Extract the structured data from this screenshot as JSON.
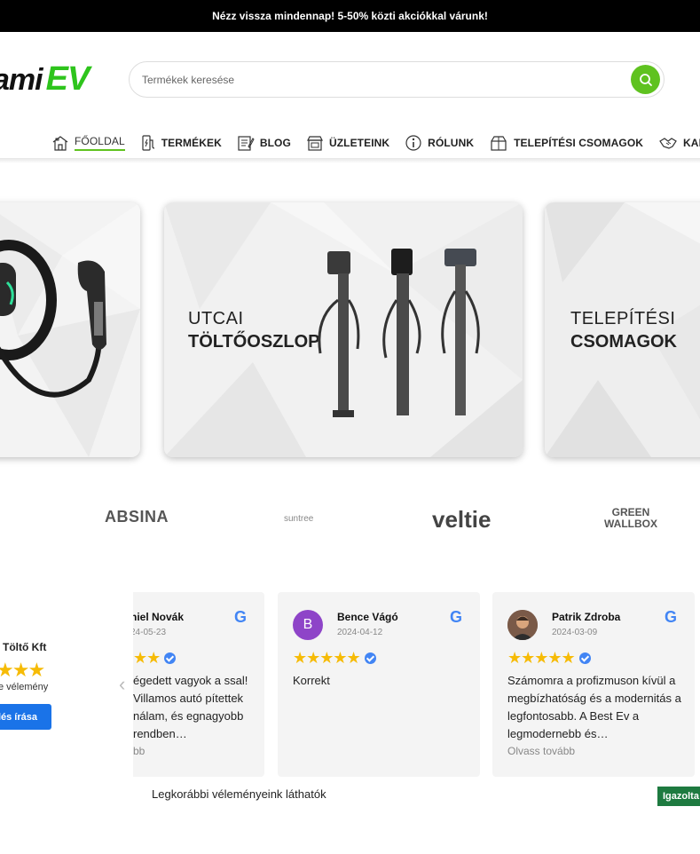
{
  "topbar": {
    "text": "Nézz vissza mindennap! 5-50% közti akciókkal várunk!"
  },
  "logo": {
    "word": "ami",
    "ev": "EV"
  },
  "search": {
    "placeholder": "Termékek keresése"
  },
  "nav": {
    "items": [
      {
        "label": "FŐOLDAL",
        "icon": "home-icon"
      },
      {
        "label": "TERMÉKEK",
        "icon": "charger-icon"
      },
      {
        "label": "BLOG",
        "icon": "blog-icon"
      },
      {
        "label": "ÜZLETEINK",
        "icon": "store-icon"
      },
      {
        "label": "RÓLUNK",
        "icon": "info-icon"
      },
      {
        "label": "TELEPÍTÉSI CSOMAGOK",
        "icon": "package-icon"
      },
      {
        "label": "KAPCSOLAT",
        "icon": "handshake-icon"
      }
    ]
  },
  "banners": [
    {
      "line1": "",
      "line2": ""
    },
    {
      "line1": "UTCAI",
      "line2": "TÖLTŐOSZLOP"
    },
    {
      "line1": "TELEPÍTÉSI",
      "line2": "CSOMAGOK"
    }
  ],
  "brands": [
    "ABSINA",
    "suntree",
    "veltie",
    "GREEN",
    "WALLBOX"
  ],
  "summary": {
    "name": "Töltő Kft",
    "stars": "★★★",
    "count": "e vélemény",
    "button": "lés írása"
  },
  "reviews": [
    {
      "name": "niel Novák",
      "date": "24-05-23",
      "avatar": "",
      "stars": "★★",
      "text": "égedett vagyok a ssal! Villamos autó pítettek nálam, és egnagyobb rendben…",
      "more": "bb"
    },
    {
      "name": "Bence Vágó",
      "date": "2024-04-12",
      "avatar": "B",
      "stars": "★★★★★",
      "text": "Korrekt",
      "more": ""
    },
    {
      "name": "Patrik Zdroba",
      "date": "2024-03-09",
      "avatar": "",
      "stars": "★★★★★",
      "text": "Számomra a profizmuson kívül a megbízhatóság és a modernitás a legfontosabb. A Best Ev a legmodernebb és…",
      "more": "Olvass tovább"
    }
  ],
  "google_letter": "G",
  "footer": {
    "note": "Legkorábbi véleményeink láthatók",
    "badge": "Igazolta"
  },
  "colors": {
    "accent": "#5fc21f",
    "logo_green": "#2ec41c",
    "star": "#f6bb06",
    "google_blue": "#4285f4",
    "badge": "#1e7a40"
  }
}
